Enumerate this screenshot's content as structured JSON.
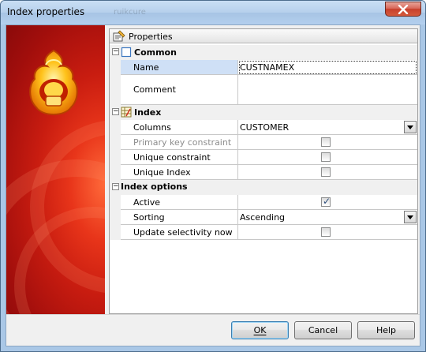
{
  "window": {
    "title": "Index properties",
    "ghost_text": "ruikcure"
  },
  "panel": {
    "header_label": "Properties"
  },
  "categories": {
    "common": "Common",
    "index": "Index",
    "index_options": "Index options"
  },
  "properties": {
    "name": {
      "label": "Name",
      "value": "CUSTNAMEX"
    },
    "comment": {
      "label": "Comment",
      "value": ""
    },
    "columns": {
      "label": "Columns",
      "value": "CUSTOMER"
    },
    "primary_key_constraint": {
      "label": "Primary key constraint",
      "checked": false,
      "enabled": false
    },
    "unique_constraint": {
      "label": "Unique constraint",
      "checked": false
    },
    "unique_index": {
      "label": "Unique Index",
      "checked": false
    },
    "active": {
      "label": "Active",
      "checked": true
    },
    "sorting": {
      "label": "Sorting",
      "value": "Ascending"
    },
    "update_selectivity_now": {
      "label": "Update selectivity now",
      "checked": false
    }
  },
  "buttons": {
    "ok": "OK",
    "cancel": "Cancel",
    "help": "Help"
  },
  "icons": {
    "close": "close-icon",
    "properties": "properties-icon",
    "common": "document-icon",
    "index": "index-icon",
    "dropdown": "chevron-down-icon",
    "logo": "firebird-logo-icon"
  },
  "colors": {
    "selection": "#cfe0f6",
    "banner": "#c81c10",
    "titlebar": "#b6d0ec"
  }
}
